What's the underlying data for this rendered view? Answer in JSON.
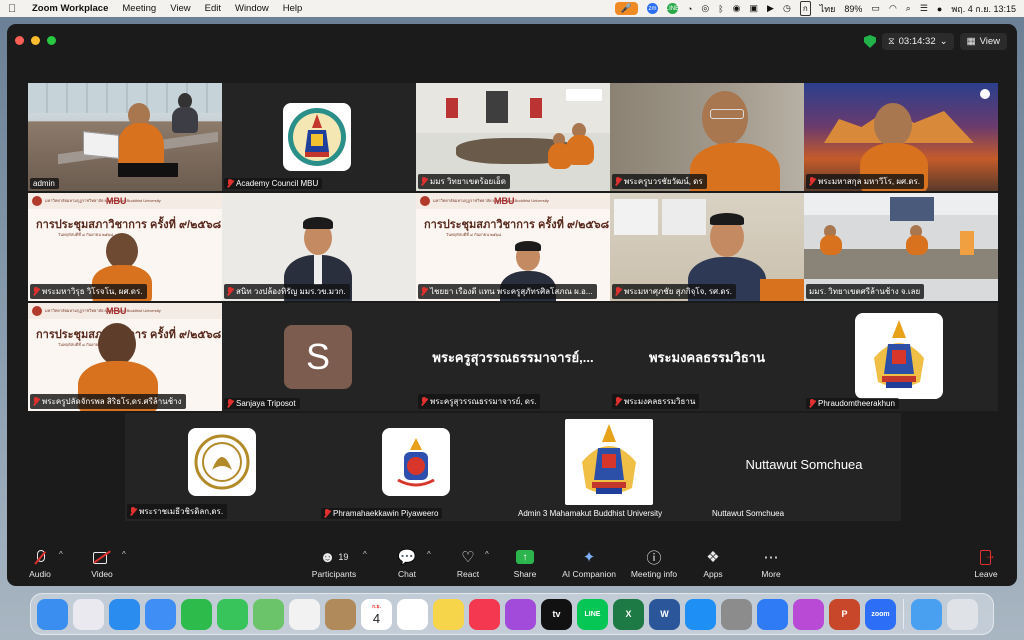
{
  "menubar": {
    "app_name": "Zoom Workplace",
    "menus": [
      "Meeting",
      "View",
      "Edit",
      "Window",
      "Help"
    ],
    "battery": "89%",
    "input_lang": "ไทย",
    "input_key": "ก",
    "clock": "พฤ. 4 ก.ย.  13:15",
    "zm_badge": "zm",
    "line_badge": "LINE"
  },
  "meeting": {
    "elapsed": "03:14:32",
    "view_label": "View"
  },
  "tiles": [
    {
      "name": "admin",
      "muted": false,
      "kind": "video-room",
      "active": true
    },
    {
      "name": "Academy Council MBU",
      "muted": true,
      "kind": "logo"
    },
    {
      "name": "มมร วิทยาเขตร้อยเอ็ด",
      "muted": true,
      "kind": "video-conf"
    },
    {
      "name": "พระครูบวรชัยวัฒน์, ดร",
      "muted": true,
      "kind": "video-monk"
    },
    {
      "name": "พระมหาสกุล มหาวีโร, ผศ.ดร.",
      "muted": true,
      "kind": "video-monk-bg"
    },
    {
      "name": "พระมหาวิรุธ วิโรจโน, ผศ.ดร.",
      "muted": true,
      "kind": "slide-monk"
    },
    {
      "name": "สนิท  วงปล้องทิรัญ มมร.วข.มวก.",
      "muted": true,
      "kind": "video-person"
    },
    {
      "name": "ไชยยา  เรืองดี  แทน  พระครูสุภัทรศิลโสภณ  ผ.อ...",
      "muted": true,
      "kind": "slide-person"
    },
    {
      "name": "พระมหาศุภชัย สุภกิจฺโจ, รศ.ดร.",
      "muted": true,
      "kind": "video-person2"
    },
    {
      "name": "มมร. วิทยาเขตศรีล้านช้าง จ.เลย",
      "muted": false,
      "kind": "video-room2"
    },
    {
      "name": "พระครูปลัดจักรพล สิริธโร,ดร.ศรีล้านช้าง",
      "muted": true,
      "kind": "slide-monk2"
    },
    {
      "name": "Sanjaya Triposot",
      "muted": true,
      "kind": "avatar",
      "initial": "S"
    },
    {
      "name": "พระครูสุวรรณธรรมาจารย์, ดร.",
      "muted": true,
      "kind": "name",
      "display": "พระครูสุวรรณธรรมาจารย์,..."
    },
    {
      "name": "พระมงคลธรรมวิธาน",
      "muted": true,
      "kind": "name",
      "display": "พระมงคลธรรมวิธาน"
    },
    {
      "name": "Phraudomtheerakhun",
      "muted": true,
      "kind": "logo"
    },
    {
      "name": "พระราชเมธีวชิรดิลก,ดร.",
      "muted": true,
      "kind": "logo-gold"
    },
    {
      "name": "Phramahaekkawin Piyaweero",
      "muted": true,
      "kind": "logo-blue"
    },
    {
      "name": "Admin 3 Mahamakut Buddhist University",
      "muted": false,
      "kind": "logo"
    },
    {
      "name": "Nuttawut Somchuea",
      "muted": false,
      "kind": "name",
      "display": "Nuttawut Somchuea"
    }
  ],
  "slide": {
    "org": "มหาวิทยาลัยมหามกุฏราชวิทยาลัย Mahamakut Buddhist University",
    "mbu": "MBU",
    "title": "การประชุมสภาวิชาการ ครั้งที่ ๙/๒๕๖๘",
    "subtitle": "วันพฤหัสบดีที่ ๔ กันยายน ๒๕๖๘"
  },
  "toolbar": {
    "audio": "Audio",
    "video": "Video",
    "participants": "Participants",
    "participants_count": "19",
    "chat": "Chat",
    "react": "React",
    "share": "Share",
    "companion": "AI Companion",
    "meeting_info": "Meeting info",
    "apps": "Apps",
    "more": "More",
    "leave": "Leave"
  },
  "dock": [
    {
      "name": "Finder",
      "color": "#3a8ef0"
    },
    {
      "name": "Launchpad",
      "color": "#e9e9ef"
    },
    {
      "name": "Safari",
      "color": "#2b8cf0"
    },
    {
      "name": "Mail",
      "color": "#3f8ef5"
    },
    {
      "name": "FaceTime",
      "color": "#2dbb4c"
    },
    {
      "name": "Messages",
      "color": "#38c35b"
    },
    {
      "name": "Maps",
      "color": "#6cc46a"
    },
    {
      "name": "Photos",
      "color": "#f2f2f2"
    },
    {
      "name": "Contacts",
      "color": "#b08a5a"
    },
    {
      "name": "Calendar",
      "color": "#ffffff",
      "label": "4",
      "sublabel": "ก.ย."
    },
    {
      "name": "Reminders",
      "color": "#ffffff"
    },
    {
      "name": "Notes",
      "color": "#f7d54a"
    },
    {
      "name": "Music",
      "color": "#f3384f"
    },
    {
      "name": "Podcasts",
      "color": "#a24ad9"
    },
    {
      "name": "Apple TV",
      "color": "#111111",
      "label": "tv"
    },
    {
      "name": "LINE",
      "color": "#06c755",
      "label": "LINE"
    },
    {
      "name": "Excel",
      "color": "#1d7a44",
      "label": "X"
    },
    {
      "name": "Word",
      "color": "#2b579a",
      "label": "W"
    },
    {
      "name": "App Store",
      "color": "#1e90f5"
    },
    {
      "name": "System Settings",
      "color": "#8c8c8c"
    },
    {
      "name": "Messenger",
      "color": "#2f7bf6"
    },
    {
      "name": "Feedback",
      "color": "#b84ad6"
    },
    {
      "name": "PowerPoint",
      "color": "#c8472a",
      "label": "P"
    },
    {
      "name": "Zoom",
      "color": "#2d6ef6",
      "label": "zoom"
    },
    {
      "name": "Downloads",
      "color": "#4aa0f0"
    },
    {
      "name": "Trash",
      "color": "#dfe3e8"
    }
  ]
}
